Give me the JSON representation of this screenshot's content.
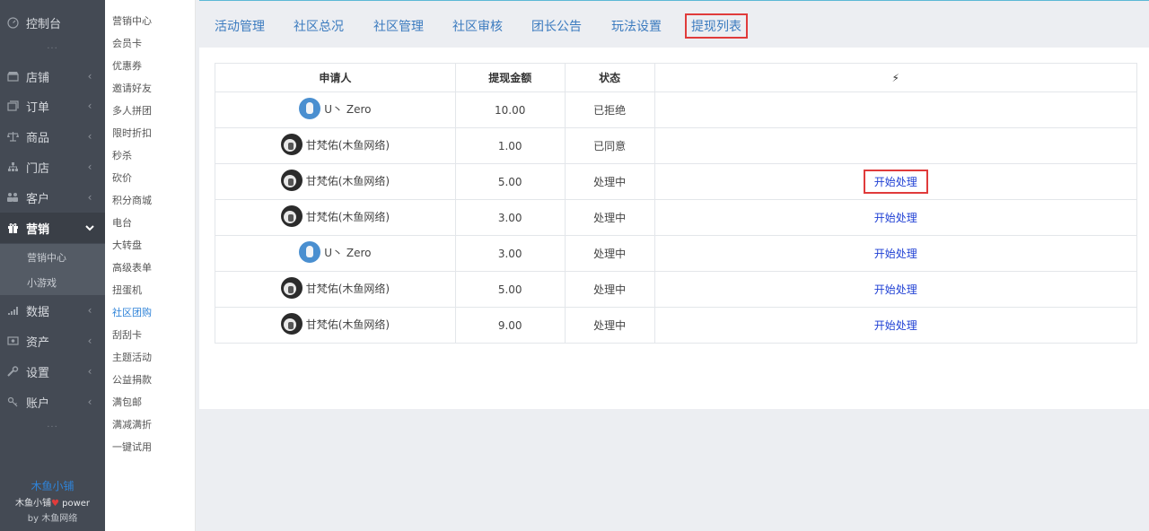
{
  "sidebar": {
    "dashboard": "控制台",
    "dots_top": "...",
    "items": [
      {
        "label": "店铺",
        "icon": "shop-icon"
      },
      {
        "label": "订单",
        "icon": "order-icon"
      },
      {
        "label": "商品",
        "icon": "scale-icon"
      },
      {
        "label": "门店",
        "icon": "store-icon"
      },
      {
        "label": "客户",
        "icon": "customers-icon"
      },
      {
        "label": "营销",
        "icon": "gift-icon"
      },
      {
        "label": "数据",
        "icon": "chart-icon"
      },
      {
        "label": "资产",
        "icon": "wallet-icon"
      },
      {
        "label": "设置",
        "icon": "wrench-icon"
      },
      {
        "label": "账户",
        "icon": "key-icon"
      }
    ],
    "sub_items": [
      "营销中心",
      "小游戏"
    ],
    "dots_bottom": "...",
    "brand_name": "木鱼小铺",
    "brand_power_prefix": "木鱼小铺",
    "brand_power_suffix": "power",
    "brand_by": "by 木鱼网络",
    "accent": "#2f83d8"
  },
  "submenu": [
    "营销中心",
    "会员卡",
    "优惠券",
    "邀请好友",
    "多人拼团",
    "限时折扣",
    "秒杀",
    "砍价",
    "积分商城",
    "电台",
    "大转盘",
    "高级表单",
    "扭蛋机",
    "社区团购",
    "刮刮卡",
    "主题活动",
    "公益捐款",
    "满包邮",
    "满减满折",
    "一键试用"
  ],
  "submenu_selected": "社区团购",
  "tabs": [
    "活动管理",
    "社区总况",
    "社区管理",
    "社区审核",
    "团长公告",
    "玩法设置",
    "提现列表"
  ],
  "active_tab": "提现列表",
  "table": {
    "headers": [
      "申请人",
      "提现金额",
      "状态",
      "⚡"
    ],
    "rows": [
      {
        "avatar": "blue",
        "name": "U丶 Zero",
        "amount": "10.00",
        "status": "已拒绝",
        "action": ""
      },
      {
        "avatar": "photo",
        "name": "甘梵佑(木鱼网络)",
        "amount": "1.00",
        "status": "已同意",
        "action": ""
      },
      {
        "avatar": "photo",
        "name": "甘梵佑(木鱼网络)",
        "amount": "5.00",
        "status": "处理中",
        "action": "开始处理"
      },
      {
        "avatar": "photo",
        "name": "甘梵佑(木鱼网络)",
        "amount": "3.00",
        "status": "处理中",
        "action": "开始处理"
      },
      {
        "avatar": "blue",
        "name": "U丶 Zero",
        "amount": "3.00",
        "status": "处理中",
        "action": "开始处理"
      },
      {
        "avatar": "photo",
        "name": "甘梵佑(木鱼网络)",
        "amount": "5.00",
        "status": "处理中",
        "action": "开始处理"
      },
      {
        "avatar": "photo",
        "name": "甘梵佑(木鱼网络)",
        "amount": "9.00",
        "status": "处理中",
        "action": "开始处理"
      }
    ]
  }
}
